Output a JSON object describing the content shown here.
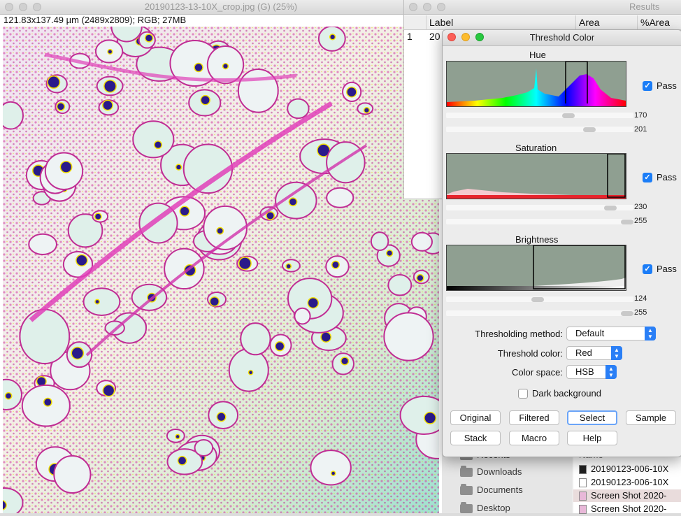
{
  "image_window": {
    "title": "20190123-13-10X_crop.jpg (G) (25%)",
    "info": "121.83x137.49 µm (2489x2809); RGB; 27MB"
  },
  "results_window": {
    "title": "Results",
    "columns": [
      "",
      "Label",
      "Area",
      "%Area"
    ],
    "rows": [
      [
        "1",
        "20",
        "",
        ""
      ]
    ]
  },
  "threshold_window": {
    "title": "Threshold Color",
    "hue": {
      "label": "Hue",
      "pass_label": "Pass",
      "pass_checked": true,
      "min": "170",
      "max": "201"
    },
    "saturation": {
      "label": "Saturation",
      "pass_label": "Pass",
      "pass_checked": true,
      "min": "230",
      "max": "255"
    },
    "brightness": {
      "label": "Brightness",
      "pass_label": "Pass",
      "pass_checked": true,
      "min": "124",
      "max": "255"
    },
    "thresholding_method": {
      "label": "Thresholding method:",
      "value": "Default"
    },
    "threshold_color": {
      "label": "Threshold color:",
      "value": "Red"
    },
    "color_space": {
      "label": "Color space:",
      "value": "HSB"
    },
    "dark_background": {
      "label": "Dark background",
      "checked": false
    },
    "buttons": {
      "original": "Original",
      "filtered": "Filtered",
      "select": "Select",
      "sample": "Sample",
      "stack": "Stack",
      "macro": "Macro",
      "help": "Help"
    }
  },
  "finder": {
    "sidebar": [
      {
        "label": "Recents"
      },
      {
        "label": "Downloads"
      },
      {
        "label": "Documents"
      },
      {
        "label": "Desktop"
      }
    ],
    "column_header": "Name",
    "files": [
      {
        "label": "20190123-006-10X"
      },
      {
        "label": "20190123-006-10X"
      },
      {
        "label": "Screen Shot 2020-"
      },
      {
        "label": "Screen Shot 2020-"
      }
    ]
  },
  "colors": {
    "accent": "#1b7df7",
    "pass_check": "#1b7df7",
    "histogram_bg": "#8f9f91"
  }
}
